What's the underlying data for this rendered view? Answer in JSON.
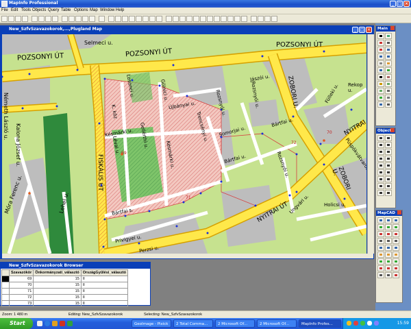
{
  "app": {
    "title": "MapInfo Professional"
  },
  "menu": [
    "File",
    "Edit",
    "Tools",
    "Objects",
    "Query",
    "Table",
    "Options",
    "Map",
    "Window",
    "Help"
  ],
  "map_window": {
    "title": "New_SzfvSzavazokorok,...,Plugland Map"
  },
  "map_labels": [
    {
      "text": "Selmeci u.",
      "rot": 0
    },
    {
      "text": "POZSONYI ÚT",
      "rot": -4
    },
    {
      "text": "POZSONYI ÚT",
      "rot": -4
    },
    {
      "text": "POZSONYI ÚT",
      "rot": 0
    },
    {
      "text": "Németh László u.",
      "rot": 90
    },
    {
      "text": "Kalona József u.",
      "rot": 90
    },
    {
      "text": "Móra Ferenc u.",
      "rot": -70
    },
    {
      "text": "Lehel u.",
      "rot": -75
    },
    {
      "text": "FISKÁLIS ÚT",
      "rot": 90
    },
    {
      "text": "Losonci u.",
      "rot": 80
    },
    {
      "text": "Gölnici u.",
      "rot": 80
    },
    {
      "text": "Újbányai u.",
      "rot": -10
    },
    {
      "text": "K. köz",
      "rot": 80
    },
    {
      "text": "Késmárki u.",
      "rot": -10
    },
    {
      "text": "Lévai u.",
      "rot": 80
    },
    {
      "text": "Gellérthi u.",
      "rot": 80
    },
    {
      "text": "Késmárki u.",
      "rot": 80
    },
    {
      "text": "Trencsényi u.",
      "rot": 75
    },
    {
      "text": "Rozsnyói u.",
      "rot": 75
    },
    {
      "text": "Jászói u.",
      "rot": -10
    },
    {
      "text": "ZOBORI U.",
      "rot": 80
    },
    {
      "text": "Rozsnyói u.",
      "rot": 80
    },
    {
      "text": "Somorjai u.",
      "rot": -15
    },
    {
      "text": "Bártfai u.",
      "rot": -15
    },
    {
      "text": "Bártfai u.",
      "rot": -15
    },
    {
      "text": "Bártfai s.",
      "rot": -10
    },
    {
      "text": "Rozsnyói u.",
      "rot": 70
    },
    {
      "text": "NYITRAI ÚT",
      "rot": -30
    },
    {
      "text": "NYITRAI",
      "rot": -30
    },
    {
      "text": "ZOBORI U.",
      "rot": 70
    },
    {
      "text": "Fülleki u.",
      "rot": -60
    },
    {
      "text": "Rekop u.",
      "rot": 0
    },
    {
      "text": "Püspökvátvaros",
      "rot": 55
    },
    {
      "text": "Holicsi u.",
      "rot": 0
    },
    {
      "text": "Ungvári u.",
      "rot": -45
    },
    {
      "text": "Privigyei u.",
      "rot": -10
    },
    {
      "text": "Perzsi u.",
      "rot": -10
    },
    {
      "text": "70",
      "rot": 0
    },
    {
      "text": "72",
      "rot": 0
    },
    {
      "text": "71",
      "rot": 0
    },
    {
      "text": "69",
      "rot": 0
    }
  ],
  "browser": {
    "title": "New_SzfvSzavazokorok Browser",
    "columns": [
      "Szavazókör",
      "Önkormányzati_választó",
      "OrszágGyűlési_választó"
    ],
    "rows": [
      [
        "69",
        "15",
        "II"
      ],
      [
        "70",
        "15",
        "II"
      ],
      [
        "71",
        "15",
        "II"
      ],
      [
        "72",
        "15",
        "II"
      ],
      [
        "73",
        "15",
        "II"
      ]
    ]
  },
  "palettes": {
    "main": {
      "title": "Main"
    },
    "objects": {
      "title": "Objects"
    },
    "mapcad": {
      "title": "MapCAD"
    }
  },
  "status": {
    "zoom": "Zoom: 1 480 m",
    "editing": "Editing: New_SzfvSzavazokorok",
    "selecting": "Selecting: New_SzfvSzavazokorok"
  },
  "taskbar": {
    "start": "Start",
    "tasks": [
      "GeoImage - Pixick",
      "2 Total Comma...",
      "2 Microsoft Of...",
      "2 Microsoft Of...",
      "MapInfo Profes..."
    ],
    "clock": "15:59"
  },
  "colors": {
    "road_yellow": "#ffe84a",
    "road_outline": "#d6a000",
    "green_area": "#c6e28f",
    "grey_area": "#bdbdbd",
    "dark_green": "#2f8a3c",
    "vertex_blue": "#1a2fd8",
    "boundary_red": "#d64040"
  }
}
